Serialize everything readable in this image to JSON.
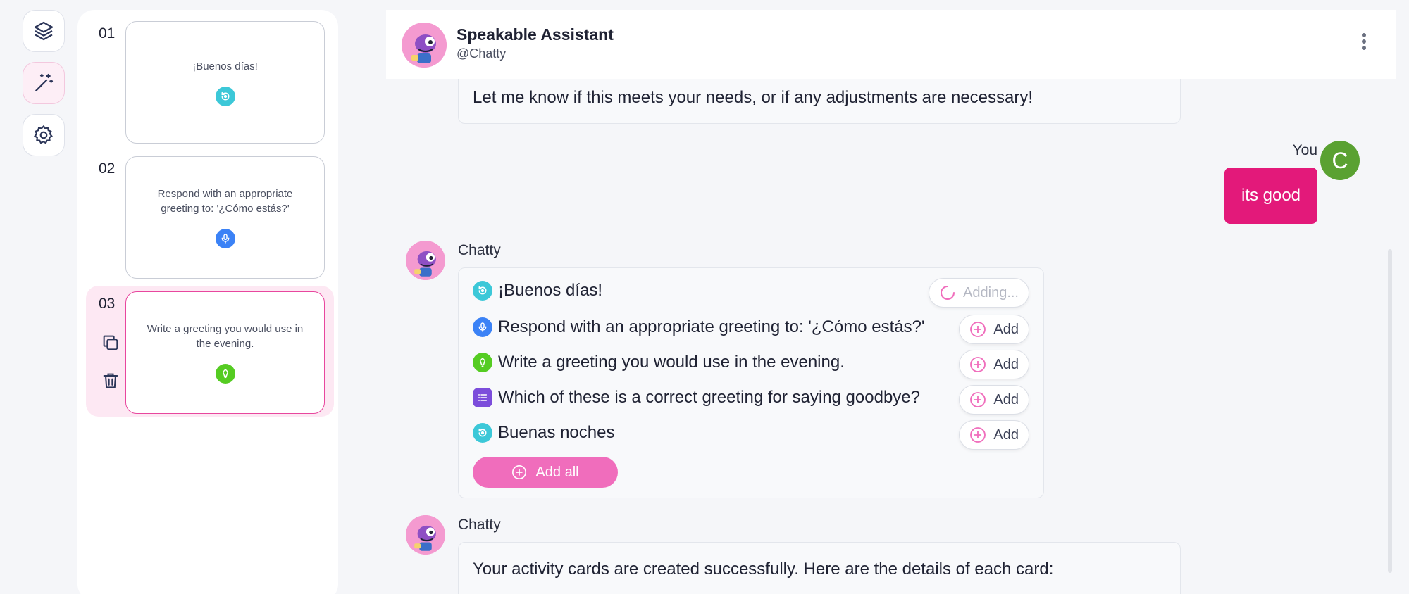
{
  "rail": {
    "items": [
      {
        "icon": "layers-icon",
        "active": false
      },
      {
        "icon": "magic-wand-icon",
        "active": true
      },
      {
        "icon": "gear-icon",
        "active": false
      }
    ]
  },
  "cards": [
    {
      "number": "01",
      "text": "¡Buenos días!",
      "icon": "repeat-audio-icon",
      "color": "#3cc8d8"
    },
    {
      "number": "02",
      "text": "Respond with an appropriate greeting to: '¿Cómo estás?'",
      "icon": "microphone-icon",
      "color": "#3b82f6"
    },
    {
      "number": "03",
      "text": "Write a greeting you would use in the evening.",
      "icon": "pencil-icon",
      "color": "#55cc22"
    }
  ],
  "header": {
    "assistant_name": "Speakable Assistant",
    "handle": "@Chatty"
  },
  "messages": {
    "prev_text": "Let me know if this meets your needs, or if any adjustments are necessary!",
    "user_label": "You",
    "user_initial": "C",
    "user_text": "its good",
    "bot_name": "Chatty",
    "suggestions": [
      {
        "text": "¡Buenos días!",
        "icon": "repeat-audio-icon",
        "color": "#3cc8d8",
        "button": "Adding...",
        "state": "adding"
      },
      {
        "text": "Respond with an appropriate greeting to: '¿Cómo estás?'",
        "icon": "microphone-icon",
        "color": "#3b82f6",
        "button": "Add",
        "state": "idle"
      },
      {
        "text": "Write a greeting you would use in the evening.",
        "icon": "pencil-icon",
        "color": "#55cc22",
        "button": "Add",
        "state": "idle"
      },
      {
        "text": "Which of these is a correct greeting for saying goodbye?",
        "icon": "list-icon",
        "color": "#7c4ddb",
        "button": "Add",
        "state": "idle"
      },
      {
        "text": "Buenas noches",
        "icon": "repeat-audio-icon",
        "color": "#3cc8d8",
        "button": "Add",
        "state": "idle"
      }
    ],
    "add_all_label": "Add all",
    "bot_name_2": "Chatty",
    "final_text": "Your activity cards are created successfully. Here are the details of each card:"
  },
  "colors": {
    "accent_pink": "#e3197a",
    "add_all_pink": "#f06dbc",
    "user_avatar_green": "#5aa132"
  }
}
